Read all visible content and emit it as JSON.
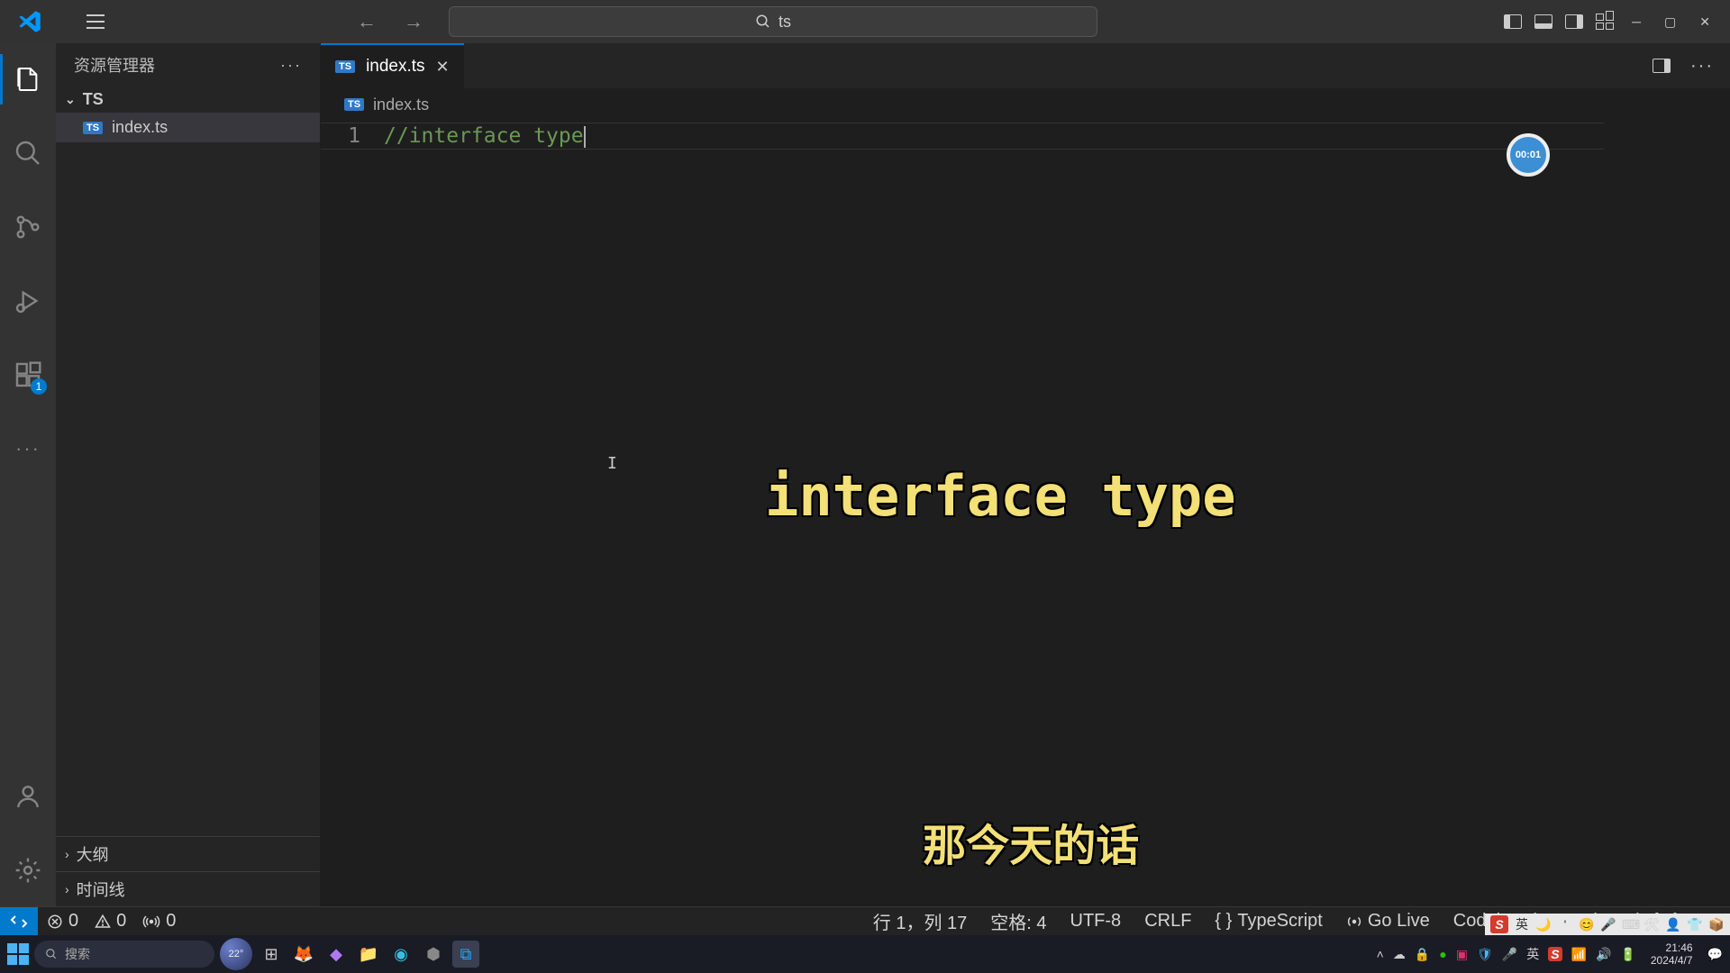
{
  "search": {
    "text": "ts"
  },
  "sidebar": {
    "title": "资源管理器",
    "folder": "TS",
    "file": "index.ts",
    "outline": "大纲",
    "timeline": "时间线"
  },
  "tab": {
    "name": "index.ts"
  },
  "breadcrumb": {
    "file": "index.ts"
  },
  "editor": {
    "line_number": "1",
    "code": "//interface type"
  },
  "timer": "00:01",
  "overlay": {
    "title": "interface type",
    "subtitle": "那今天的话"
  },
  "status": {
    "errors": "0",
    "warnings": "0",
    "ports": "0",
    "cursor": "行 1，列 17",
    "spaces": "空格: 4",
    "encoding": "UTF-8",
    "eol": "CRLF",
    "lang": "TypeScript",
    "golive": "Go Live",
    "codeium": "Codeium (Pre-Release): {...}"
  },
  "extensions_badge": "1",
  "taskbar": {
    "search_placeholder": "搜索",
    "weather": "22°",
    "lang": "英",
    "time": "21:46",
    "date": "2024/4/7"
  },
  "ime": {
    "lang": "英"
  }
}
